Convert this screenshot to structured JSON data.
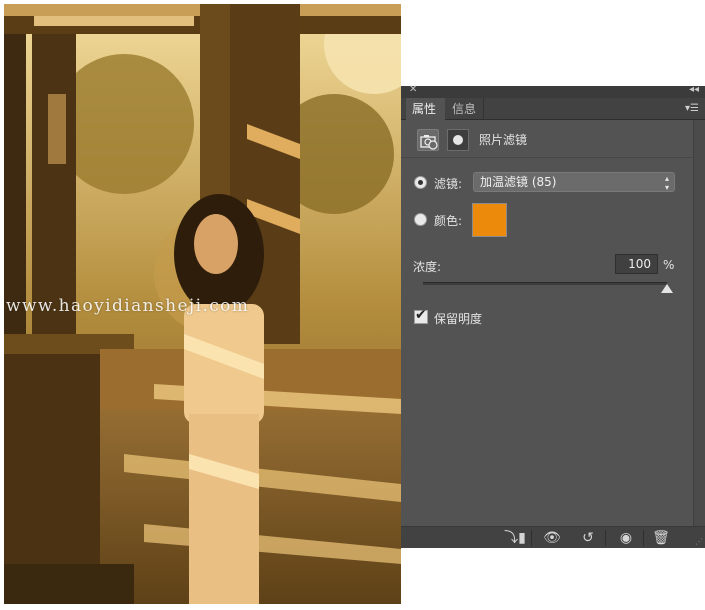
{
  "photo": {
    "watermark": "www.haoyidiansheji.com",
    "subject": "person-photo"
  },
  "panel": {
    "tabs": [
      {
        "label": "属性",
        "active": true
      },
      {
        "label": "信息",
        "active": false
      }
    ],
    "close_icon": "close-icon",
    "collapse_icon": "double-chevron-icon",
    "menu_icon": "panel-menu-icon",
    "header": {
      "title": "照片滤镜"
    },
    "filter": {
      "label": "滤镜:",
      "selected": "加温滤镜 (85)",
      "checked": true
    },
    "color": {
      "label": "颜色:",
      "value": "#ec8a0b",
      "checked": false
    },
    "density": {
      "label": "浓度:",
      "value": "100",
      "unit": "%",
      "fraction": 1.0
    },
    "preserve": {
      "label": "保留明度",
      "checked": true
    },
    "bottom_icons": [
      "clip-to-layer-icon",
      "view-previous-state-icon",
      "reset-icon",
      "visibility-eye-icon",
      "trash-icon"
    ]
  }
}
